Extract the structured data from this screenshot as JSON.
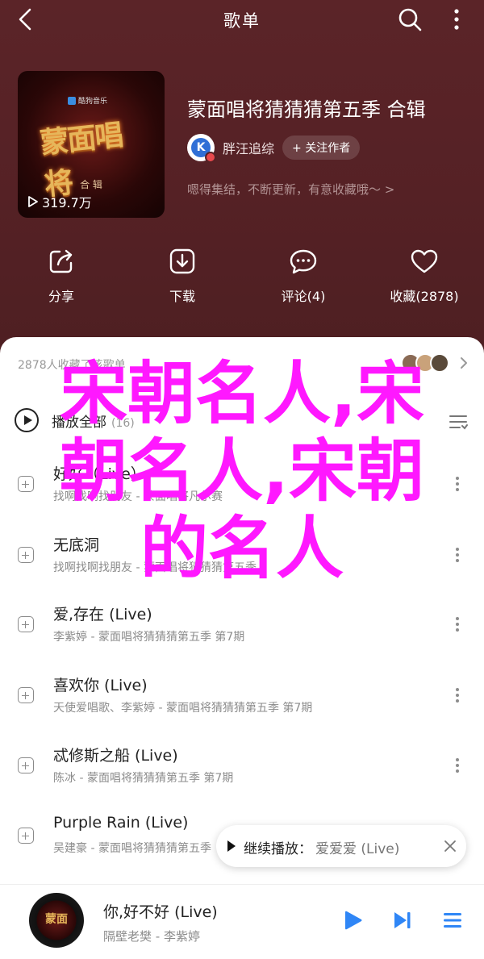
{
  "header": {
    "title": "歌单"
  },
  "album": {
    "title": "蒙面唱将猜猜猜第五季 合辑",
    "cover_badge": "酷狗音乐",
    "cover_logo": "蒙面唱将",
    "cover_sub": "合 辑",
    "play_count": "319.7万",
    "creator": "胖汪追综",
    "creator_avatar_letter": "K",
    "follow_label": "+ 关注作者",
    "description": "嗯得集结，不断更新，有意收藏哦～ >"
  },
  "actions": [
    {
      "label": "分享",
      "icon": "share-icon"
    },
    {
      "label": "下载",
      "icon": "download-icon"
    },
    {
      "label": "评论(4)",
      "icon": "comment-icon"
    },
    {
      "label": "收藏(2878)",
      "icon": "heart-icon"
    }
  ],
  "collectors": {
    "text": "2878人收藏了该歌单"
  },
  "play_all": {
    "label": "播放全部",
    "count": "(16)"
  },
  "songs": [
    {
      "title": "好好（Live）",
      "subtitle": "找啊找啊找朋友 - 蒙面唱将凡尔赛"
    },
    {
      "title": "无底洞",
      "subtitle": "找啊找啊找朋友 - 蒙面唱将猜猜猜第五季"
    },
    {
      "title": "爱,存在 (Live)",
      "subtitle": "李紫婷 - 蒙面唱将猜猜猜第五季 第7期"
    },
    {
      "title": "喜欢你 (Live)",
      "subtitle": "天使爱唱歌、李紫婷 - 蒙面唱将猜猜猜第五季 第7期"
    },
    {
      "title": "忒修斯之船 (Live)",
      "subtitle": "陈冰 - 蒙面唱将猜猜猜第五季 第7期"
    },
    {
      "title": "Purple Rain (Live)",
      "subtitle": "吴建豪 - 蒙面唱将猜猜猜第五季"
    }
  ],
  "toast": {
    "label": "继续播放：",
    "song": "爱爱爱 (Live)"
  },
  "player": {
    "title": "你,好不好 (Live)",
    "artist": "隔壁老樊 - 李紫婷",
    "disc_text": "蒙面"
  },
  "watermark": {
    "lines": [
      "宋朝名人,宋",
      "朝名人,宋朝",
      "的名人"
    ]
  },
  "colors": {
    "header_bg": "#552125",
    "accent_play": "#2f86f6",
    "watermark": "#ff18ff"
  }
}
